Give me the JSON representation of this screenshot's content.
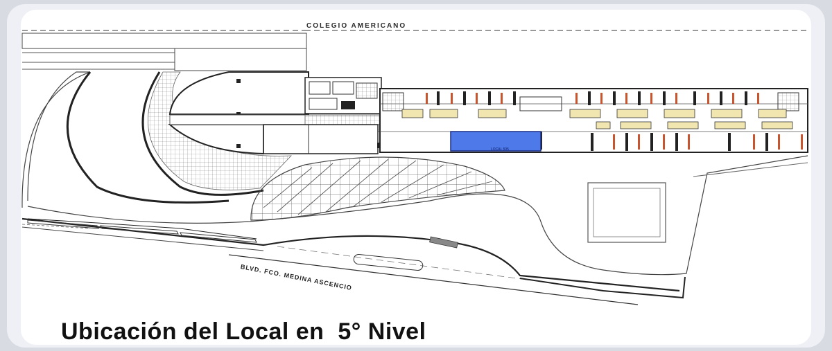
{
  "diagram": {
    "school_label": "COLEGIO AMERICANO",
    "street_label": "BLVD. FCO. MEDINA ASCENCIO",
    "local_label": "LOCAL 505",
    "caption": "Ubicación del Local en  5° Nivel"
  },
  "colors": {
    "highlight_local": "#4e79e8",
    "accent_columns": "#c8552e",
    "lines": "#333333"
  }
}
